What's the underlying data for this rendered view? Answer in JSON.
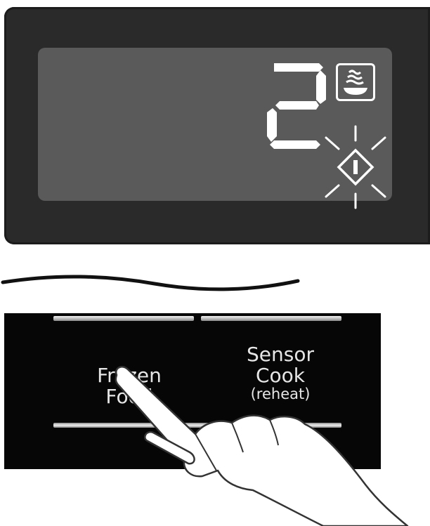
{
  "display": {
    "digit": "2",
    "program_icon": "bowl-with-steam-icon",
    "start_icon": "start-diamond-icon",
    "start_state": "flashing"
  },
  "keys": {
    "frozen_food": {
      "line1": "Frozen",
      "line2": "Food"
    },
    "sensor_cook": {
      "line1": "Sensor",
      "line2": "Cook",
      "line3": "(reheat)"
    }
  },
  "colors": {
    "display_frame": "#2a2a2a",
    "lcd": "#5a5a5a",
    "segment": "#ffffff",
    "panel": "#060606",
    "key_text": "#e6e6e6"
  }
}
